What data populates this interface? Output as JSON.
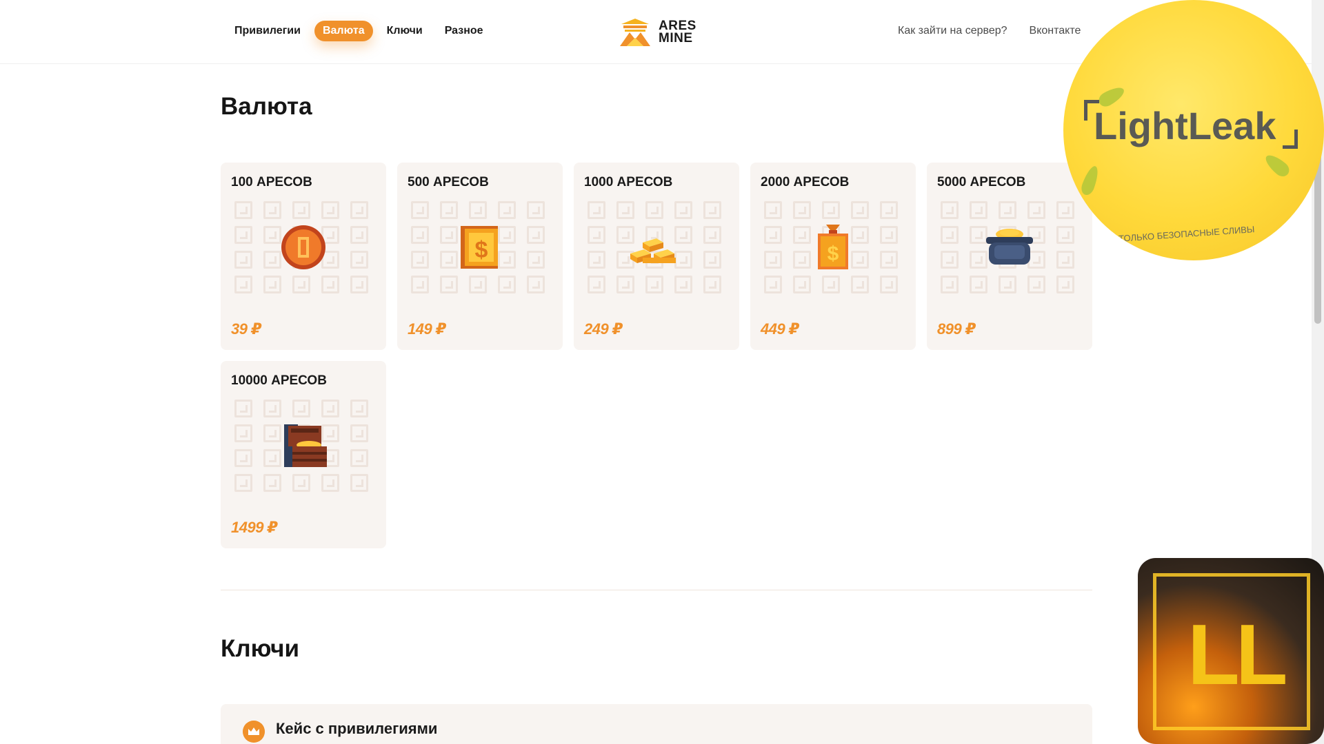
{
  "header": {
    "nav": [
      "Привилегии",
      "Валюта",
      "Ключи",
      "Разное"
    ],
    "active_nav": "Валюта",
    "logo_line1": "ARES",
    "logo_line2": "MINE",
    "links": [
      "Как зайти на сервер?",
      "Вконтакте"
    ]
  },
  "sections": {
    "currency_title": "Валюта",
    "keys_title": "Ключи"
  },
  "products": [
    {
      "title": "100 АРЕСОВ",
      "price": "39 ₽",
      "icon": "coin-icon"
    },
    {
      "title": "500 АРЕСОВ",
      "price": "149 ₽",
      "icon": "dollar-coin-icon"
    },
    {
      "title": "1000 АРЕСОВ",
      "price": "249 ₽",
      "icon": "gold-bars-icon"
    },
    {
      "title": "2000 АРЕСОВ",
      "price": "449 ₽",
      "icon": "money-bag-icon"
    },
    {
      "title": "5000 АРЕСОВ",
      "price": "899 ₽",
      "icon": "pot-of-gold-icon"
    },
    {
      "title": "10000 АРЕСОВ",
      "price": "1499 ₽",
      "icon": "treasure-chest-icon"
    }
  ],
  "cases": [
    {
      "title": "Кейс с привилегиями",
      "icon": "crown-icon"
    }
  ],
  "watermarks": {
    "circle_text": "LightLeak",
    "circle_sub": "ТОЛЬКО БЕЗОПАСНЫЕ СЛИВЫ",
    "square_text": "LL"
  },
  "colors": {
    "accent": "#f0912b",
    "card_bg": "#f8f4f1",
    "text": "#1c1c1c"
  }
}
